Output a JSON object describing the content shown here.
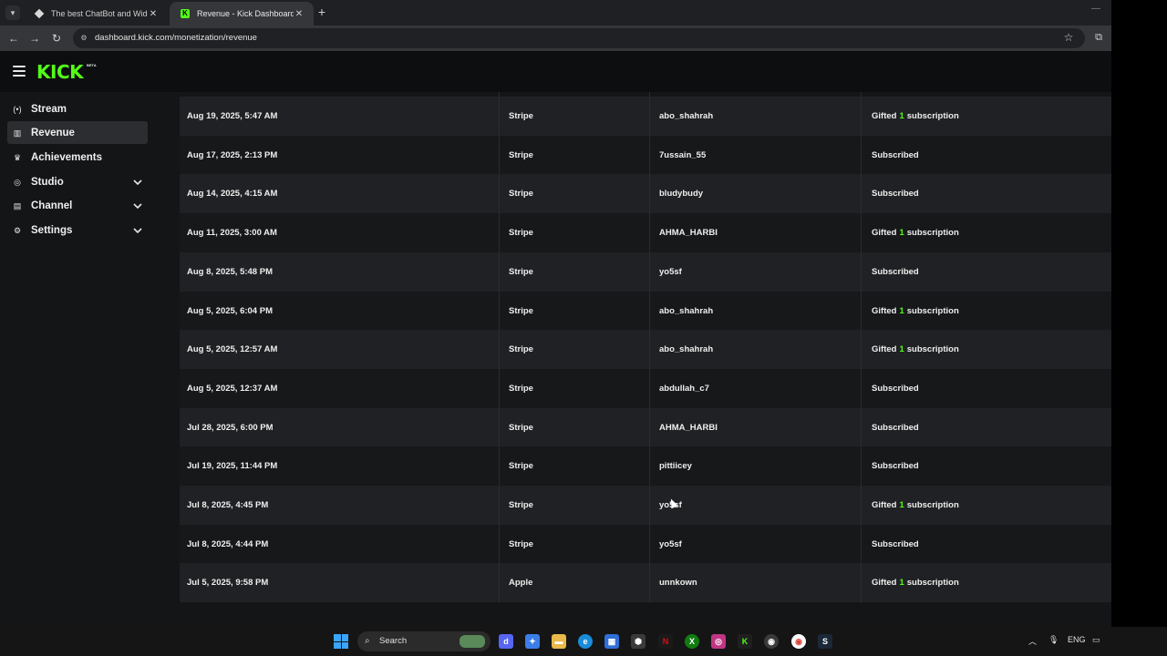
{
  "browser": {
    "tabs": [
      {
        "title": "The best ChatBot and Widgets",
        "active": false,
        "close": "✕"
      },
      {
        "title": "Revenue - Kick Dashboard",
        "active": true,
        "close": "✕"
      }
    ],
    "new_tab": "+",
    "url": "dashboard.kick.com/monetization/revenue"
  },
  "header": {
    "logo": "KICK",
    "beta": "BETA"
  },
  "sidebar": {
    "items": [
      {
        "label": "Stream",
        "icon": "broadcast-icon",
        "selected": false,
        "expandable": false
      },
      {
        "label": "Revenue",
        "icon": "revenue-icon",
        "selected": true,
        "expandable": false
      },
      {
        "label": "Achievements",
        "icon": "trophy-icon",
        "selected": false,
        "expandable": false
      },
      {
        "label": "Studio",
        "icon": "studio-icon",
        "selected": false,
        "expandable": true
      },
      {
        "label": "Channel",
        "icon": "channel-icon",
        "selected": false,
        "expandable": true
      },
      {
        "label": "Settings",
        "icon": "gear-icon",
        "selected": false,
        "expandable": true
      }
    ]
  },
  "revenue_table": {
    "rows": [
      {
        "date": "Aug 19, 2025, 5:47 AM",
        "method": "Stripe",
        "user": "abo_shahrah",
        "type": "gift",
        "count": "1"
      },
      {
        "date": "Aug 17, 2025, 2:13 PM",
        "method": "Stripe",
        "user": "7ussain_55",
        "type": "sub"
      },
      {
        "date": "Aug 14, 2025, 4:15 AM",
        "method": "Stripe",
        "user": "bludybudy",
        "type": "sub"
      },
      {
        "date": "Aug 11, 2025, 3:00 AM",
        "method": "Stripe",
        "user": "AHMA_HARBI",
        "type": "gift",
        "count": "1"
      },
      {
        "date": "Aug 8, 2025, 5:48 PM",
        "method": "Stripe",
        "user": "yo5sf",
        "type": "sub"
      },
      {
        "date": "Aug 5, 2025, 6:04 PM",
        "method": "Stripe",
        "user": "abo_shahrah",
        "type": "gift",
        "count": "1"
      },
      {
        "date": "Aug 5, 2025, 12:57 AM",
        "method": "Stripe",
        "user": "abo_shahrah",
        "type": "gift",
        "count": "1"
      },
      {
        "date": "Aug 5, 2025, 12:37 AM",
        "method": "Stripe",
        "user": "abdullah_c7",
        "type": "sub"
      },
      {
        "date": "Jul 28, 2025, 6:00 PM",
        "method": "Stripe",
        "user": "AHMA_HARBI",
        "type": "sub"
      },
      {
        "date": "Jul 19, 2025, 11:44 PM",
        "method": "Stripe",
        "user": "pittiicey",
        "type": "sub"
      },
      {
        "date": "Jul 8, 2025, 4:45 PM",
        "method": "Stripe",
        "user": "yo5sf",
        "type": "gift",
        "count": "1"
      },
      {
        "date": "Jul 8, 2025, 4:44 PM",
        "method": "Stripe",
        "user": "yo5sf",
        "type": "sub"
      },
      {
        "date": "Jul 5, 2025, 9:58 PM",
        "method": "Apple",
        "user": "unnkown",
        "type": "gift",
        "count": "1"
      }
    ],
    "labels": {
      "subscribed": "Subscribed",
      "gifted_prefix": "Gifted",
      "gifted_suffix": "subscription"
    }
  },
  "taskbar": {
    "search_label": "Search",
    "language": "ENG"
  },
  "colors": {
    "accent": "#53fc18",
    "row_odd": "#202124",
    "row_even": "#17181a"
  }
}
